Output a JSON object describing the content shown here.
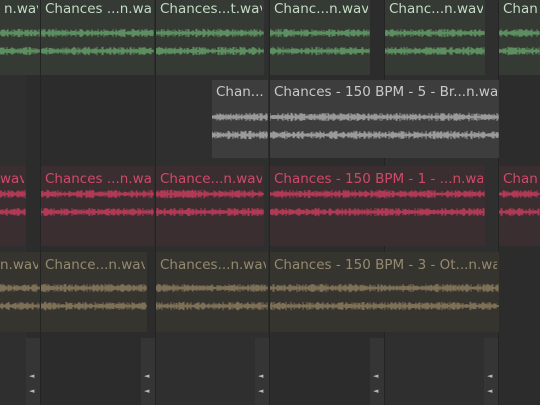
{
  "arrangement": {
    "tracks": [
      {
        "name": "track-green",
        "color": "#5d8e60",
        "title_color": "#c4dcc4",
        "clip_bg": "#353a35",
        "clips": [
          {
            "title": "n.wav"
          },
          {
            "title": "Chances ...n.wav"
          },
          {
            "title": "Chances...t.wav"
          },
          {
            "title": "Chanc...n.wav"
          },
          {
            "title": "Chanc...n.wav"
          },
          {
            "title": "Chanc"
          }
        ]
      },
      {
        "name": "track-grey",
        "color": "#9a9a9a",
        "title_color": "#c9c9c9",
        "clip_bg": "#3d3d3d",
        "clips": [
          {
            "title": "Chan..."
          },
          {
            "title": "Chances - 150 BPM - 5 - Br...n.wav"
          }
        ]
      },
      {
        "name": "track-red",
        "color": "#b03a55",
        "title_color": "#d04a68",
        "clip_bg": "#3a2e31",
        "clips": [
          {
            "title": "wav"
          },
          {
            "title": "Chances ...n.wav"
          },
          {
            "title": "Chance...n.wav"
          },
          {
            "title": "Chances - 150 BPM - 1 - ...n.wav"
          },
          {
            "title": "Chanc"
          }
        ]
      },
      {
        "name": "track-olive",
        "color": "#7d7057",
        "title_color": "#948a70",
        "clip_bg": "#36342f",
        "clips": [
          {
            "title": "n.wav"
          },
          {
            "title": "Chance...n.wav"
          },
          {
            "title": "Chances...n.wav"
          },
          {
            "title": "Chances - 150 BPM - 3 - Ot...n.wav"
          }
        ]
      }
    ],
    "markers": [
      "◄",
      "◄",
      "◄",
      "◄",
      "◄"
    ]
  }
}
